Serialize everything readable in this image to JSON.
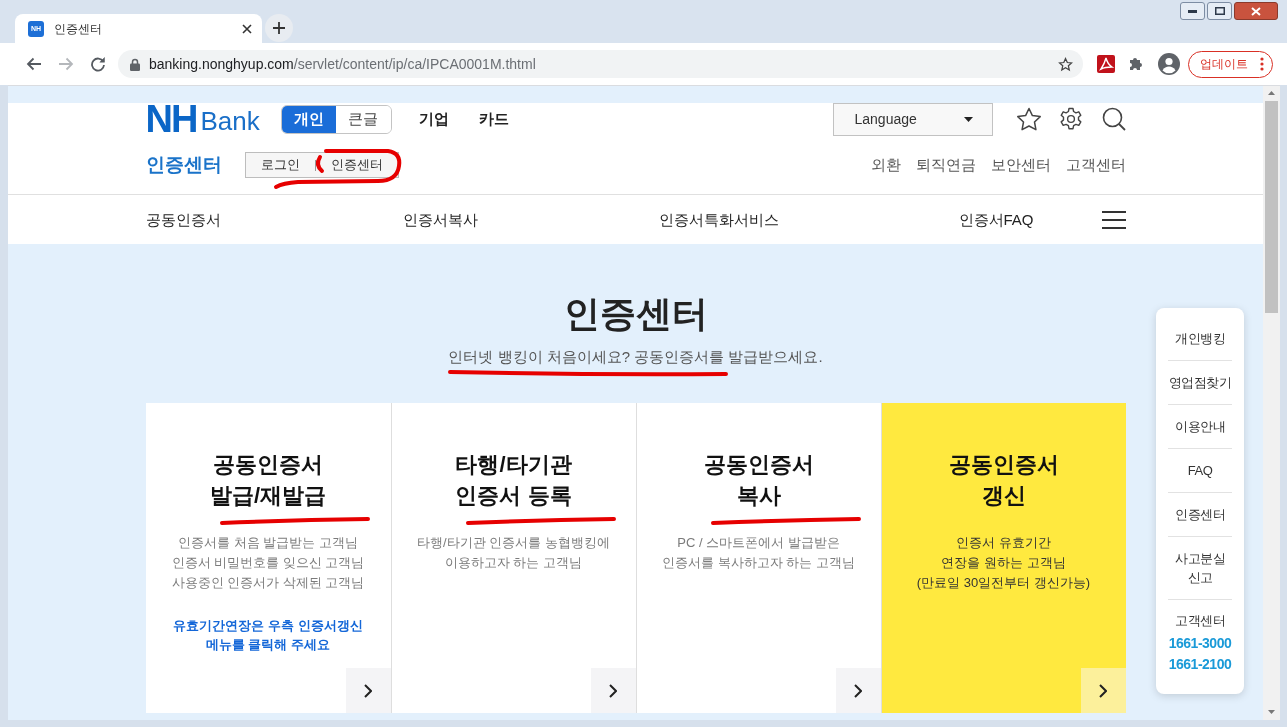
{
  "browser": {
    "tab": {
      "favicon": "NH",
      "title": "인증센터"
    },
    "nav_buttons": [
      {
        "kind": "back",
        "disabled": false
      },
      {
        "kind": "forward",
        "disabled": true
      },
      {
        "kind": "reload",
        "disabled": false
      }
    ],
    "url": {
      "host": "banking.nonghyup.com",
      "path": "/servlet/content/ip/ca/IPCA0001M.thtml"
    },
    "update_button": "업데이트"
  },
  "header": {
    "logo": {
      "mark": "NH",
      "word": "Bank"
    },
    "view_toggle": [
      {
        "label": "개인",
        "selected": true
      },
      {
        "label": "큰글",
        "selected": false
      }
    ],
    "menu": [
      "기업",
      "카드"
    ],
    "language": "Language",
    "section_title": "인증센터",
    "sub_buttons": [
      {
        "label": "로그인",
        "marked": false
      },
      {
        "label": "인증센터",
        "marked": true
      }
    ],
    "util_links": [
      "외환",
      "퇴직연금",
      "보안센터",
      "고객센터"
    ],
    "nav": [
      "공동인증서",
      "인증서복사",
      "인증서특화서비스",
      "인증서FAQ"
    ]
  },
  "hero": {
    "title": "인증센터",
    "subtitle": {
      "text": "인터넷 뱅킹이 처음이세요? 공동인증서를 발급받으세요.",
      "marked": true
    }
  },
  "cards": [
    {
      "kind": "plain",
      "title": "공동인증서\n발급/재발급",
      "marked": true,
      "description": "인증서를 처음 발급받는 고객님\n인증서 비밀번호를 잊으신 고객님\n사용중인 인증서가 삭제된 고객님",
      "note": "유효기간연장은 우측 인증서갱신\n메뉴를 클릭해 주세요"
    },
    {
      "kind": "plain",
      "title": "타행/타기관\n인증서 등록",
      "marked": true,
      "description": "타행/타기관 인증서를 농협뱅킹에\n이용하고자 하는 고객님"
    },
    {
      "kind": "plain",
      "title": "공동인증서\n복사",
      "marked": true,
      "description": "PC / 스마트폰에서 발급받은\n인증서를 복사하고자 하는 고객님"
    },
    {
      "kind": "highlight",
      "title": "공동인증서\n갱신",
      "marked": false,
      "description": "인증서 유효기간\n연장을 원하는 고객님\n(만료일 30일전부터 갱신가능)"
    }
  ],
  "quick_menu": {
    "items": [
      {
        "kind": "link",
        "label": "개인뱅킹"
      },
      {
        "kind": "link",
        "label": "영업점찾기"
      },
      {
        "kind": "link",
        "label": "이용안내"
      },
      {
        "kind": "link",
        "label": "FAQ"
      },
      {
        "kind": "link",
        "label": "인증센터"
      },
      {
        "kind": "link",
        "label": "사고분실\n신고"
      },
      {
        "kind": "contact",
        "label": "고객센터",
        "phones": [
          "1661-3000",
          "1661-2100"
        ]
      }
    ]
  }
}
